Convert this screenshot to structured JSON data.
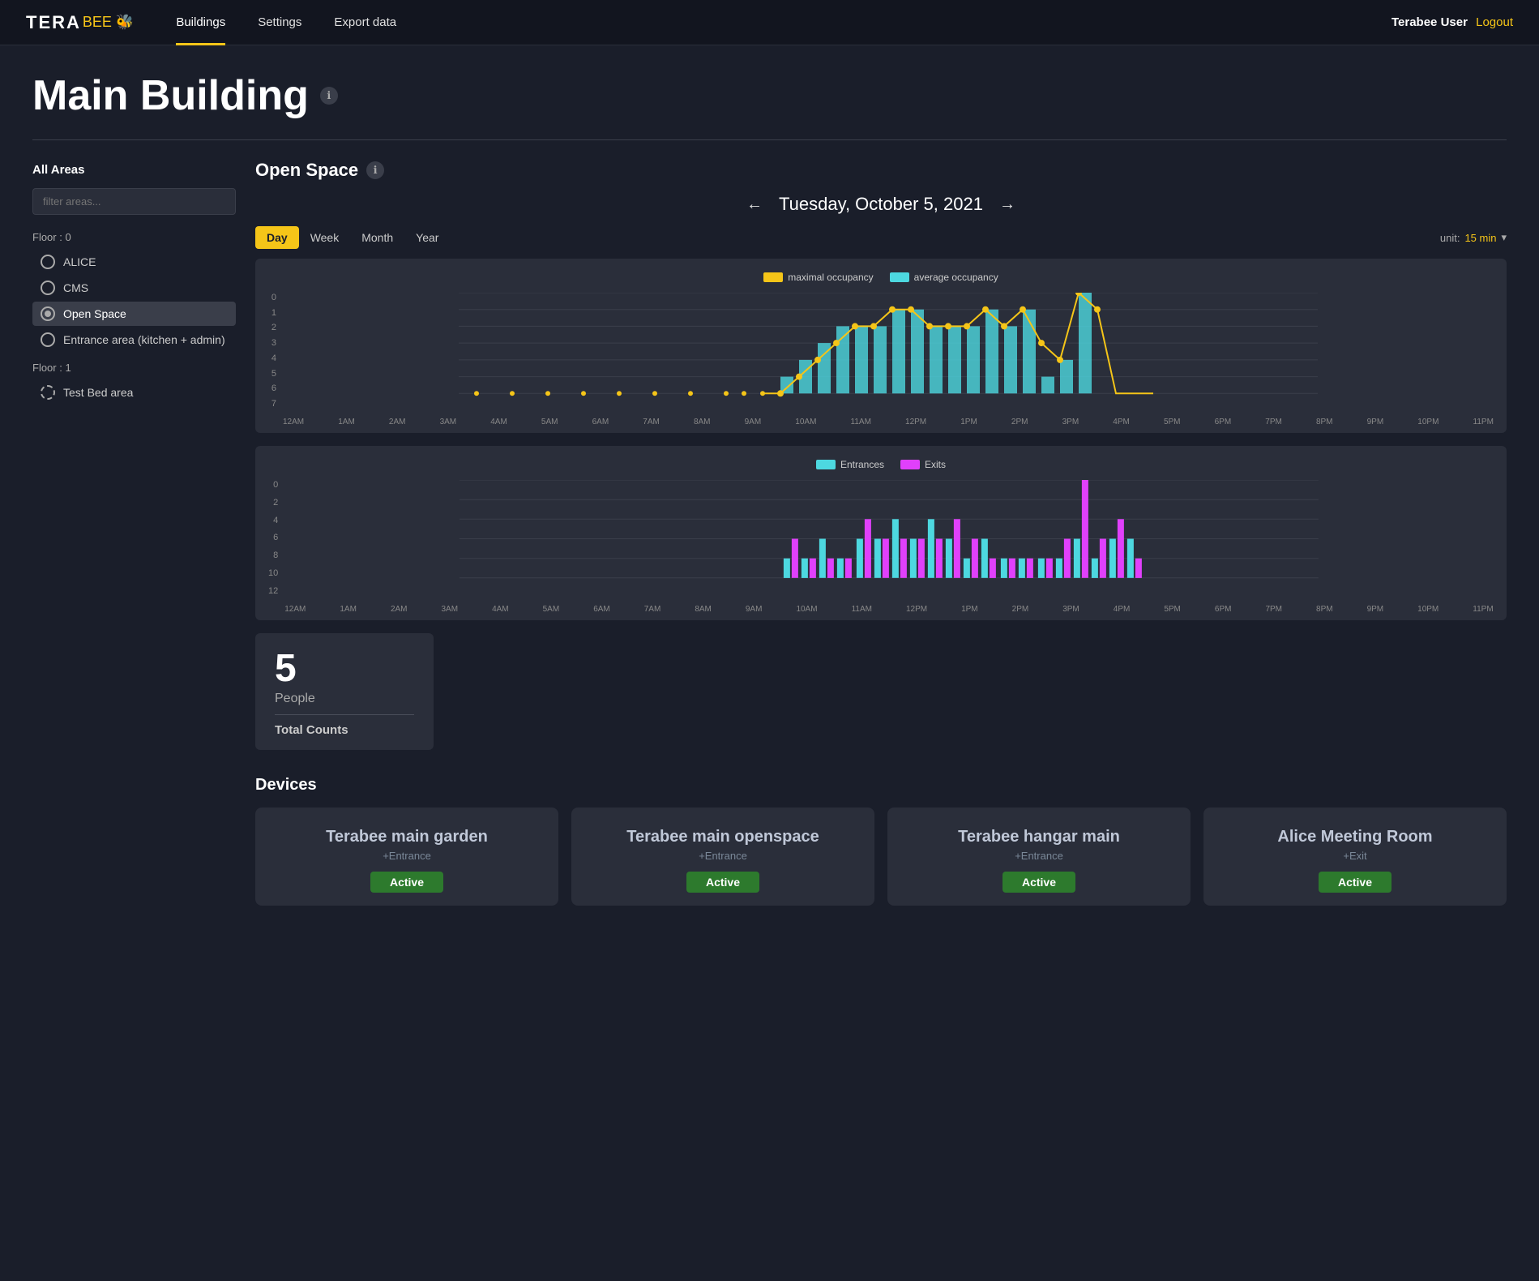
{
  "nav": {
    "logo": "TERA",
    "logo_accent": "BEE",
    "logo_icon": "🐝",
    "links": [
      {
        "label": "Buildings",
        "active": true
      },
      {
        "label": "Settings",
        "active": false
      },
      {
        "label": "Export data",
        "active": false
      }
    ],
    "user": "Terabee User",
    "logout": "Logout"
  },
  "page": {
    "title": "Main Building",
    "info_icon": "ℹ"
  },
  "sidebar": {
    "title": "All Areas",
    "filter_placeholder": "filter areas...",
    "floor0": {
      "label": "Floor : 0",
      "items": [
        "ALICE",
        "CMS",
        "Open Space",
        "Entrance area (kitchen + admin)"
      ]
    },
    "floor1": {
      "label": "Floor : 1",
      "items": [
        "Test Bed area"
      ]
    }
  },
  "content": {
    "section_title": "Open Space",
    "date": "Tuesday, October 5, 2021",
    "tabs": [
      "Day",
      "Week",
      "Month",
      "Year"
    ],
    "active_tab": "Day",
    "unit_label": "unit:",
    "unit_value": "15 min",
    "chart1": {
      "legend": [
        {
          "label": "maximal occupancy",
          "color": "#f5c518"
        },
        {
          "label": "average occupancy",
          "color": "#4dd8e0"
        }
      ],
      "y_labels": [
        "0",
        "1",
        "2",
        "3",
        "4",
        "5",
        "6",
        "7"
      ],
      "x_labels": [
        "12AM",
        "1AM",
        "2AM",
        "3AM",
        "4AM",
        "5AM",
        "6AM",
        "7AM",
        "8AM",
        "9AM",
        "10AM",
        "11AM",
        "12PM",
        "1PM",
        "2PM",
        "3PM",
        "4PM",
        "5PM",
        "6PM",
        "7PM",
        "8PM",
        "9PM",
        "10PM",
        "11PM"
      ]
    },
    "chart2": {
      "legend": [
        {
          "label": "Entrances",
          "color": "#4dd8e0"
        },
        {
          "label": "Exits",
          "color": "#e040fb"
        }
      ],
      "y_labels": [
        "0",
        "2",
        "4",
        "6",
        "8",
        "10",
        "12"
      ],
      "x_labels": [
        "12AM",
        "1AM",
        "2AM",
        "3AM",
        "4AM",
        "5AM",
        "6AM",
        "7AM",
        "8AM",
        "9AM",
        "10AM",
        "11AM",
        "12PM",
        "1PM",
        "2PM",
        "3PM",
        "4PM",
        "5PM",
        "6PM",
        "7PM",
        "8PM",
        "9PM",
        "10PM",
        "11PM"
      ]
    },
    "stats": {
      "number": "5",
      "people_label": "People",
      "total_label": "Total Counts"
    },
    "devices_title": "Devices",
    "devices": [
      {
        "name": "Terabee main garden",
        "type": "+Entrance",
        "status": "Active"
      },
      {
        "name": "Terabee main openspace",
        "type": "+Entrance",
        "status": "Active"
      },
      {
        "name": "Terabee hangar main",
        "type": "+Entrance",
        "status": "Active"
      },
      {
        "name": "Alice Meeting Room",
        "type": "+Exit",
        "status": "Active"
      }
    ]
  }
}
